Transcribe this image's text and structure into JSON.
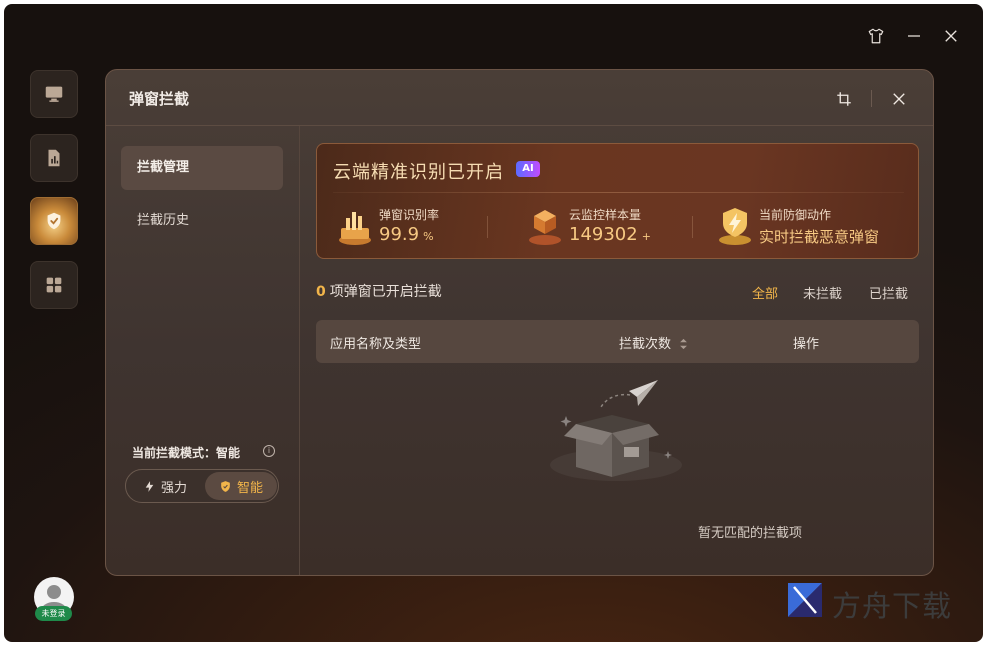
{
  "window": {
    "controls": [
      "shirt-icon",
      "minimize-icon",
      "close-icon"
    ]
  },
  "sidebar": {
    "items": [
      {
        "name": "monitor-icon"
      },
      {
        "name": "report-icon"
      },
      {
        "name": "popup-shield-icon",
        "active": true
      },
      {
        "name": "apps-grid-icon"
      }
    ],
    "login_badge": "未登录"
  },
  "dialog": {
    "title": "弹窗拦截",
    "nav": [
      {
        "label": "拦截管理",
        "active": true
      },
      {
        "label": "拦截历史",
        "active": false
      }
    ],
    "mode": {
      "label": "当前拦截模式：智能",
      "options": [
        {
          "label": "强力",
          "active": false
        },
        {
          "label": "智能",
          "active": true
        }
      ]
    },
    "banner": {
      "title": "云端精准识别已开启",
      "ai_badge": "AI",
      "stats": [
        {
          "label": "弹窗识别率",
          "value": "99.9",
          "unit": "%"
        },
        {
          "label": "云监控样本量",
          "value": "149302",
          "unit": "+"
        },
        {
          "label": "当前防御动作",
          "value": "实时拦截恶意弹窗",
          "unit": ""
        }
      ]
    },
    "summary": {
      "count": "0",
      "text": "项弹窗已开启拦截"
    },
    "filters": [
      {
        "label": "全部",
        "active": true
      },
      {
        "label": "未拦截",
        "active": false
      },
      {
        "label": "已拦截",
        "active": false
      }
    ],
    "table": {
      "columns": [
        "应用名称及类型",
        "拦截次数",
        "操作"
      ]
    },
    "empty_text": "暂无匹配的拦截项"
  },
  "watermark": {
    "text": "方舟下载"
  },
  "colors": {
    "accent": "#f2b54a",
    "banner_title": "#f6dcb2",
    "login_badge": "#1f8a4a"
  }
}
